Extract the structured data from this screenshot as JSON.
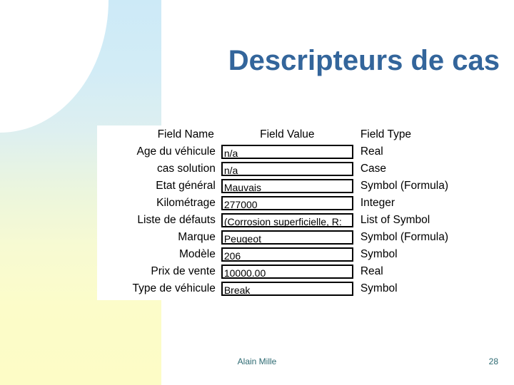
{
  "slide": {
    "title": "Descripteurs de cas",
    "title_color": "#33659b",
    "background_color": "#ffffff",
    "decoration": {
      "name": "corner-gradient-band",
      "top_color": "#cdeaf7",
      "bottom_color": "#fdfcc6"
    }
  },
  "table": {
    "headers": {
      "name": "Field Name",
      "value": "Field Value",
      "type": "Field Type"
    },
    "rows": [
      {
        "name": "Age du véhicule",
        "value": "n/a",
        "type": "Real"
      },
      {
        "name": "cas solution",
        "value": "n/a",
        "type": "Case"
      },
      {
        "name": "Etat général",
        "value": "Mauvais",
        "type": "Symbol (Formula)"
      },
      {
        "name": "Kilométrage",
        "value": "277000",
        "type": "Integer"
      },
      {
        "name": "Liste de défauts",
        "value": "(Corrosion superficielle, R:",
        "type": "List of Symbol"
      },
      {
        "name": "Marque",
        "value": "Peugeot",
        "type": "Symbol (Formula)"
      },
      {
        "name": "Modèle",
        "value": "206",
        "type": "Symbol"
      },
      {
        "name": "Prix de vente",
        "value": "10000.00",
        "type": "Real"
      },
      {
        "name": "Type de véhicule",
        "value": "Break",
        "type": "Symbol"
      }
    ]
  },
  "footer": {
    "author": "Alain Mille",
    "page_number": "28",
    "color": "#2d6a72"
  }
}
